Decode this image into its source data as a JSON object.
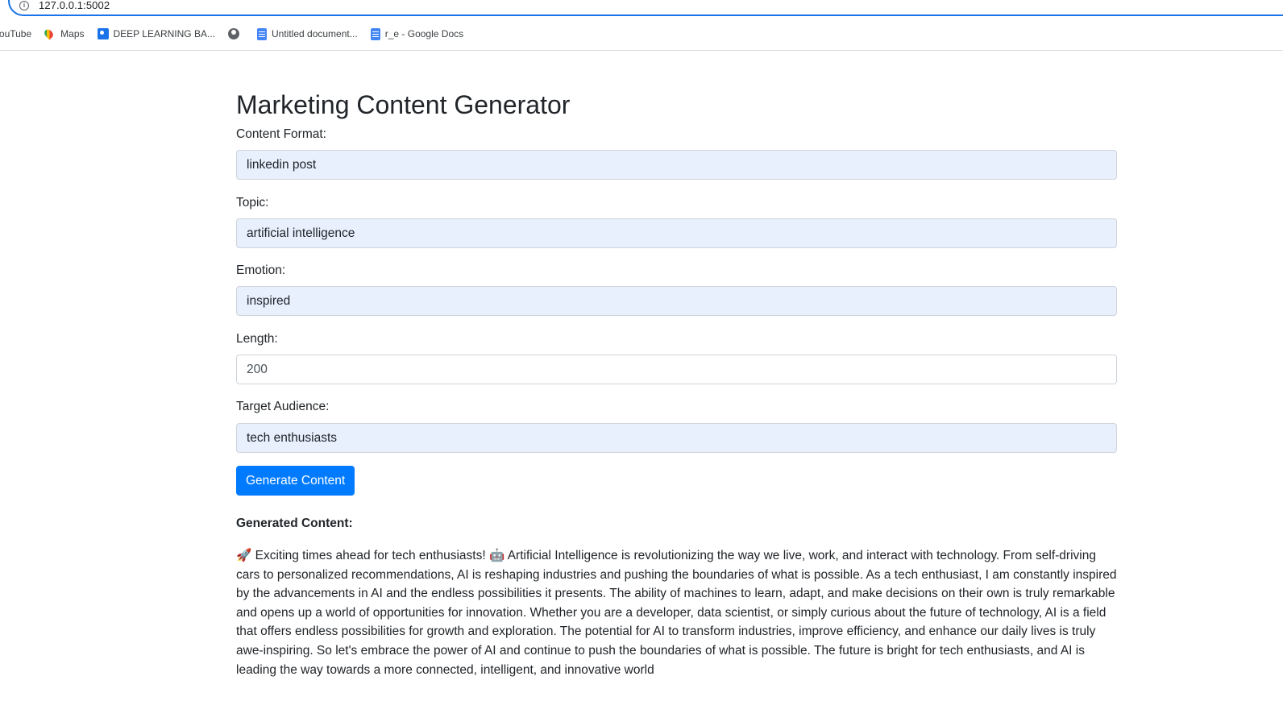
{
  "browser": {
    "url": "127.0.0.1:5002",
    "bookmarks": [
      {
        "label": "YouTube",
        "icon": "youtube-icon"
      },
      {
        "label": "Maps",
        "icon": "maps-pin-icon"
      },
      {
        "label": "DEEP LEARNING BA...",
        "icon": "contact-card-icon"
      },
      {
        "label": "",
        "icon": "globe-icon"
      },
      {
        "label": "Untitled document...",
        "icon": "google-docs-icon"
      },
      {
        "label": "r_e - Google Docs",
        "icon": "google-docs-icon"
      }
    ]
  },
  "page": {
    "title": "Marketing Content Generator",
    "fields": {
      "format": {
        "label": "Content Format:",
        "value": "linkedin post"
      },
      "topic": {
        "label": "Topic:",
        "value": "artificial intelligence"
      },
      "emotion": {
        "label": "Emotion:",
        "value": "inspired"
      },
      "length": {
        "label": "Length:",
        "value": "200"
      },
      "audience": {
        "label": "Target Audience:",
        "value": "tech enthusiasts"
      }
    },
    "generate_button": "Generate Content",
    "generated_heading": "Generated Content:",
    "generated_text": "🚀 Exciting times ahead for tech enthusiasts! 🤖 Artificial Intelligence is revolutionizing the way we live, work, and interact with technology. From self-driving cars to personalized recommendations, AI is reshaping industries and pushing the boundaries of what is possible. As a tech enthusiast, I am constantly inspired by the advancements in AI and the endless possibilities it presents. The ability of machines to learn, adapt, and make decisions on their own is truly remarkable and opens up a world of opportunities for innovation. Whether you are a developer, data scientist, or simply curious about the future of technology, AI is a field that offers endless possibilities for growth and exploration. The potential for AI to transform industries, improve efficiency, and enhance our daily lives is truly awe-inspiring. So let's embrace the power of AI and continue to push the boundaries of what is possible. The future is bright for tech enthusiasts, and AI is leading the way towards a more connected, intelligent, and innovative world"
  },
  "colors": {
    "primary_button": "#007bff",
    "autofill_background": "#e8f0fe",
    "address_bar_focus": "#1a73e8"
  }
}
